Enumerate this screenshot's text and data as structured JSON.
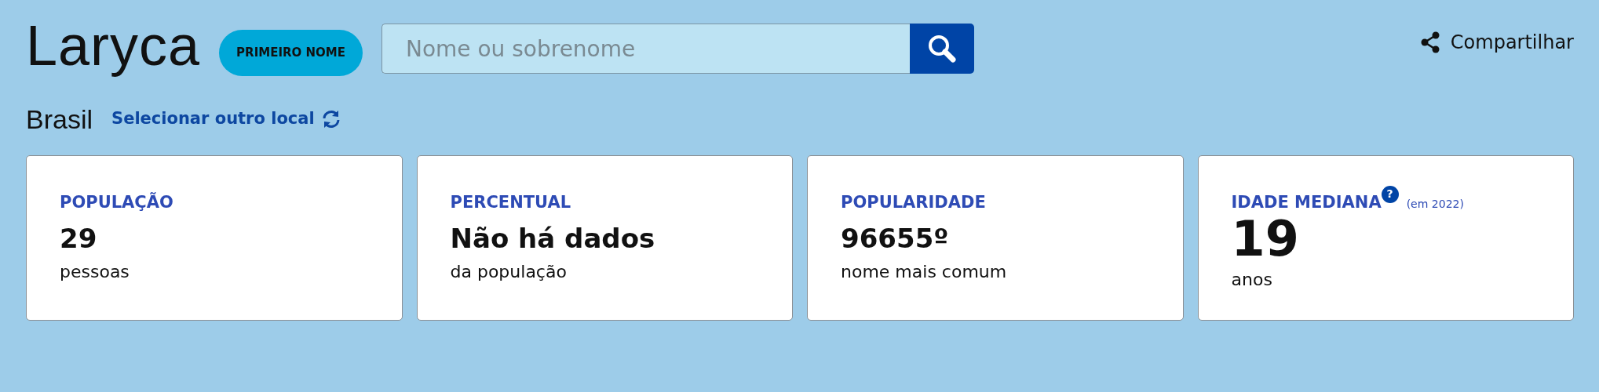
{
  "name_title": "Laryca",
  "badge": "PRIMEIRO NOME",
  "search": {
    "placeholder": "Nome ou sobrenome"
  },
  "share": {
    "label": "Compartilhar"
  },
  "location": {
    "name": "Brasil",
    "link": "Selecionar outro local"
  },
  "cards": [
    {
      "kind": "standard",
      "label": "POPULAÇÃO",
      "value": "29",
      "caption": "pessoas"
    },
    {
      "kind": "standard",
      "label": "PERCENTUAL",
      "value": "Não há dados",
      "caption": "da população"
    },
    {
      "kind": "standard",
      "label": "POPULARIDADE",
      "value": "96655º",
      "caption": "nome mais comum"
    },
    {
      "kind": "big",
      "label": "IDADE MEDIANA",
      "help": "?",
      "note": "(em 2022)",
      "value": "19",
      "caption": "anos"
    }
  ]
}
